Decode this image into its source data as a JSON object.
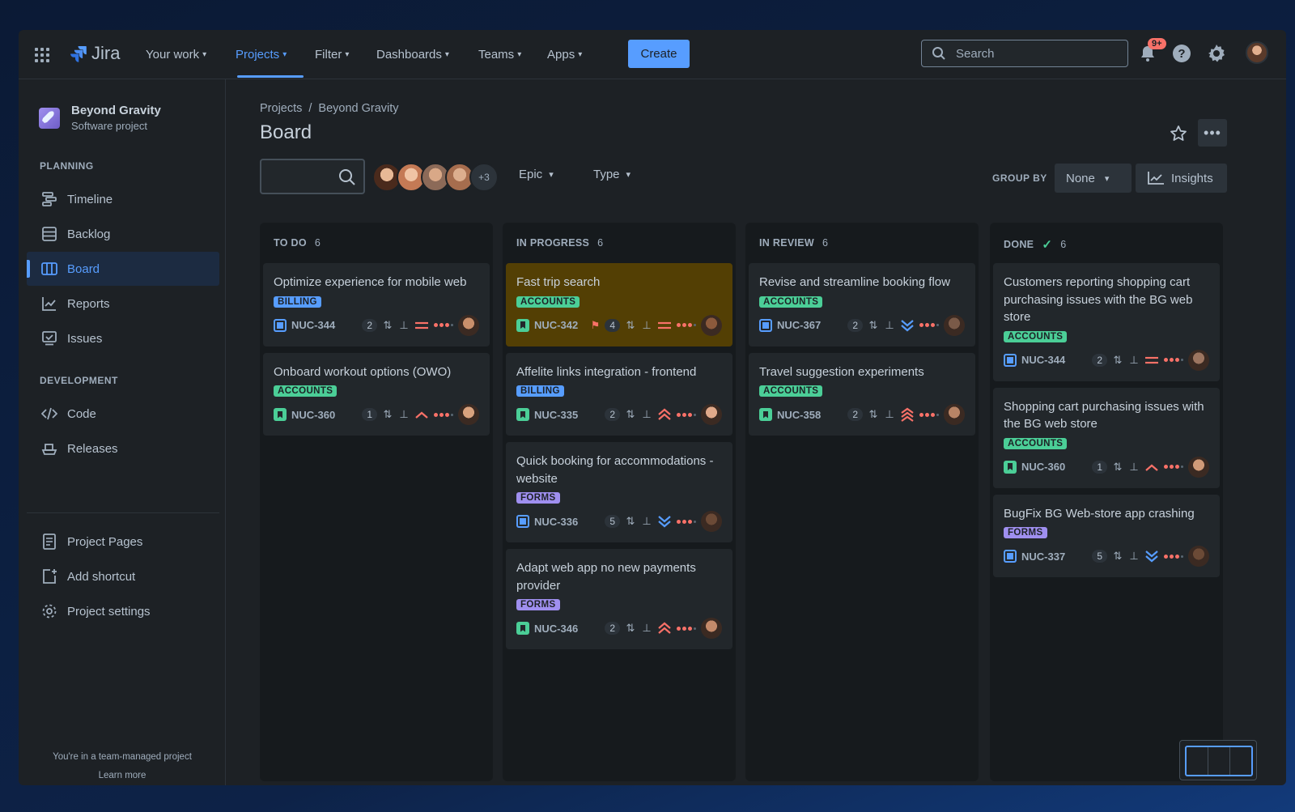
{
  "topnav": {
    "logo": "Jira",
    "items": [
      "Your work",
      "Projects",
      "Filter",
      "Dashboards",
      "Teams",
      "Apps"
    ],
    "create_label": "Create",
    "search_placeholder": "Search",
    "notifications_badge": "9+"
  },
  "sidebar": {
    "project_name": "Beyond Gravity",
    "project_type": "Software project",
    "planning_header": "PLANNING",
    "planning_items": [
      "Timeline",
      "Backlog",
      "Board",
      "Reports",
      "Issues"
    ],
    "development_header": "DEVELOPMENT",
    "development_items": [
      "Code",
      "Releases"
    ],
    "other_items": [
      "Project Pages",
      "Add shortcut",
      "Project settings"
    ],
    "footer_text": "You're in a team-managed project",
    "footer_link": "Learn more"
  },
  "main": {
    "breadcrumb": [
      "Projects",
      "Beyond Gravity"
    ],
    "breadcrumb_sep": "/",
    "title": "Board",
    "more_avatars": "+3",
    "filters": [
      "Epic",
      "Type"
    ],
    "group_by_label": "GROUP BY",
    "group_by_value": "None",
    "insights_label": "Insights"
  },
  "columns": [
    {
      "title": "TO DO",
      "count": "6",
      "done": false,
      "cards": [
        {
          "title": "Optimize experience for mobile web",
          "label": "BILLING",
          "type": "task",
          "key": "NUC-344",
          "flag": false,
          "points": "2",
          "priority": "medium",
          "avatar": "#c98f6b"
        },
        {
          "title": "Onboard workout options (OWO)",
          "label": "ACCOUNTS",
          "type": "story",
          "key": "NUC-360",
          "flag": false,
          "points": "1",
          "priority": "low-up",
          "avatar": "#d8a27e"
        }
      ]
    },
    {
      "title": "IN PROGRESS",
      "count": "6",
      "done": false,
      "cards": [
        {
          "title": "Fast trip search",
          "label": "ACCOUNTS",
          "type": "story",
          "key": "NUC-342",
          "flag": true,
          "points": "4",
          "priority": "medium",
          "avatar": "#8c5a3c"
        },
        {
          "title": "Affelite links integration - frontend",
          "label": "BILLING",
          "type": "story",
          "key": "NUC-335",
          "flag": false,
          "points": "2",
          "priority": "high",
          "avatar": "#e0a98a"
        },
        {
          "title": "Quick booking for accommodations - website",
          "label": "FORMS",
          "type": "task",
          "key": "NUC-336",
          "flag": false,
          "points": "5",
          "priority": "lowest",
          "avatar": "#6b4a36"
        },
        {
          "title": "Adapt web app no new payments provider",
          "label": "FORMS",
          "type": "story",
          "key": "NUC-346",
          "flag": false,
          "points": "2",
          "priority": "high",
          "avatar": "#c48a6a"
        }
      ]
    },
    {
      "title": "IN REVIEW",
      "count": "6",
      "done": false,
      "cards": [
        {
          "title": "Revise and streamline booking flow",
          "label": "ACCOUNTS",
          "type": "task",
          "key": "NUC-367",
          "flag": false,
          "points": "2",
          "priority": "lowest",
          "avatar": "#7a5a48"
        },
        {
          "title": "Travel suggestion experiments",
          "label": "ACCOUNTS",
          "type": "story",
          "key": "NUC-358",
          "flag": false,
          "points": "2",
          "priority": "highest",
          "avatar": "#b88466"
        }
      ]
    },
    {
      "title": "DONE",
      "count": "6",
      "done": true,
      "cards": [
        {
          "title": "Customers reporting shopping cart purchasing issues with the BG web store",
          "label": "ACCOUNTS",
          "type": "task",
          "key": "NUC-344",
          "flag": false,
          "points": "2",
          "priority": "medium",
          "avatar": "#9c7560"
        },
        {
          "title": "Shopping cart purchasing issues with the BG web store",
          "label": "ACCOUNTS",
          "type": "story",
          "key": "NUC-360",
          "flag": false,
          "points": "1",
          "priority": "low-up",
          "avatar": "#d09a78"
        },
        {
          "title": "BugFix BG Web-store app crashing",
          "label": "FORMS",
          "type": "task",
          "key": "NUC-337",
          "flag": false,
          "points": "5",
          "priority": "lowest",
          "avatar": "#6b4a36"
        }
      ]
    }
  ],
  "colors": {
    "accent": "#579dff",
    "accounts": "#4bce97",
    "billing": "#579dff",
    "forms": "#9f8fef",
    "danger": "#f87168",
    "flagged_card": "#533f04"
  }
}
